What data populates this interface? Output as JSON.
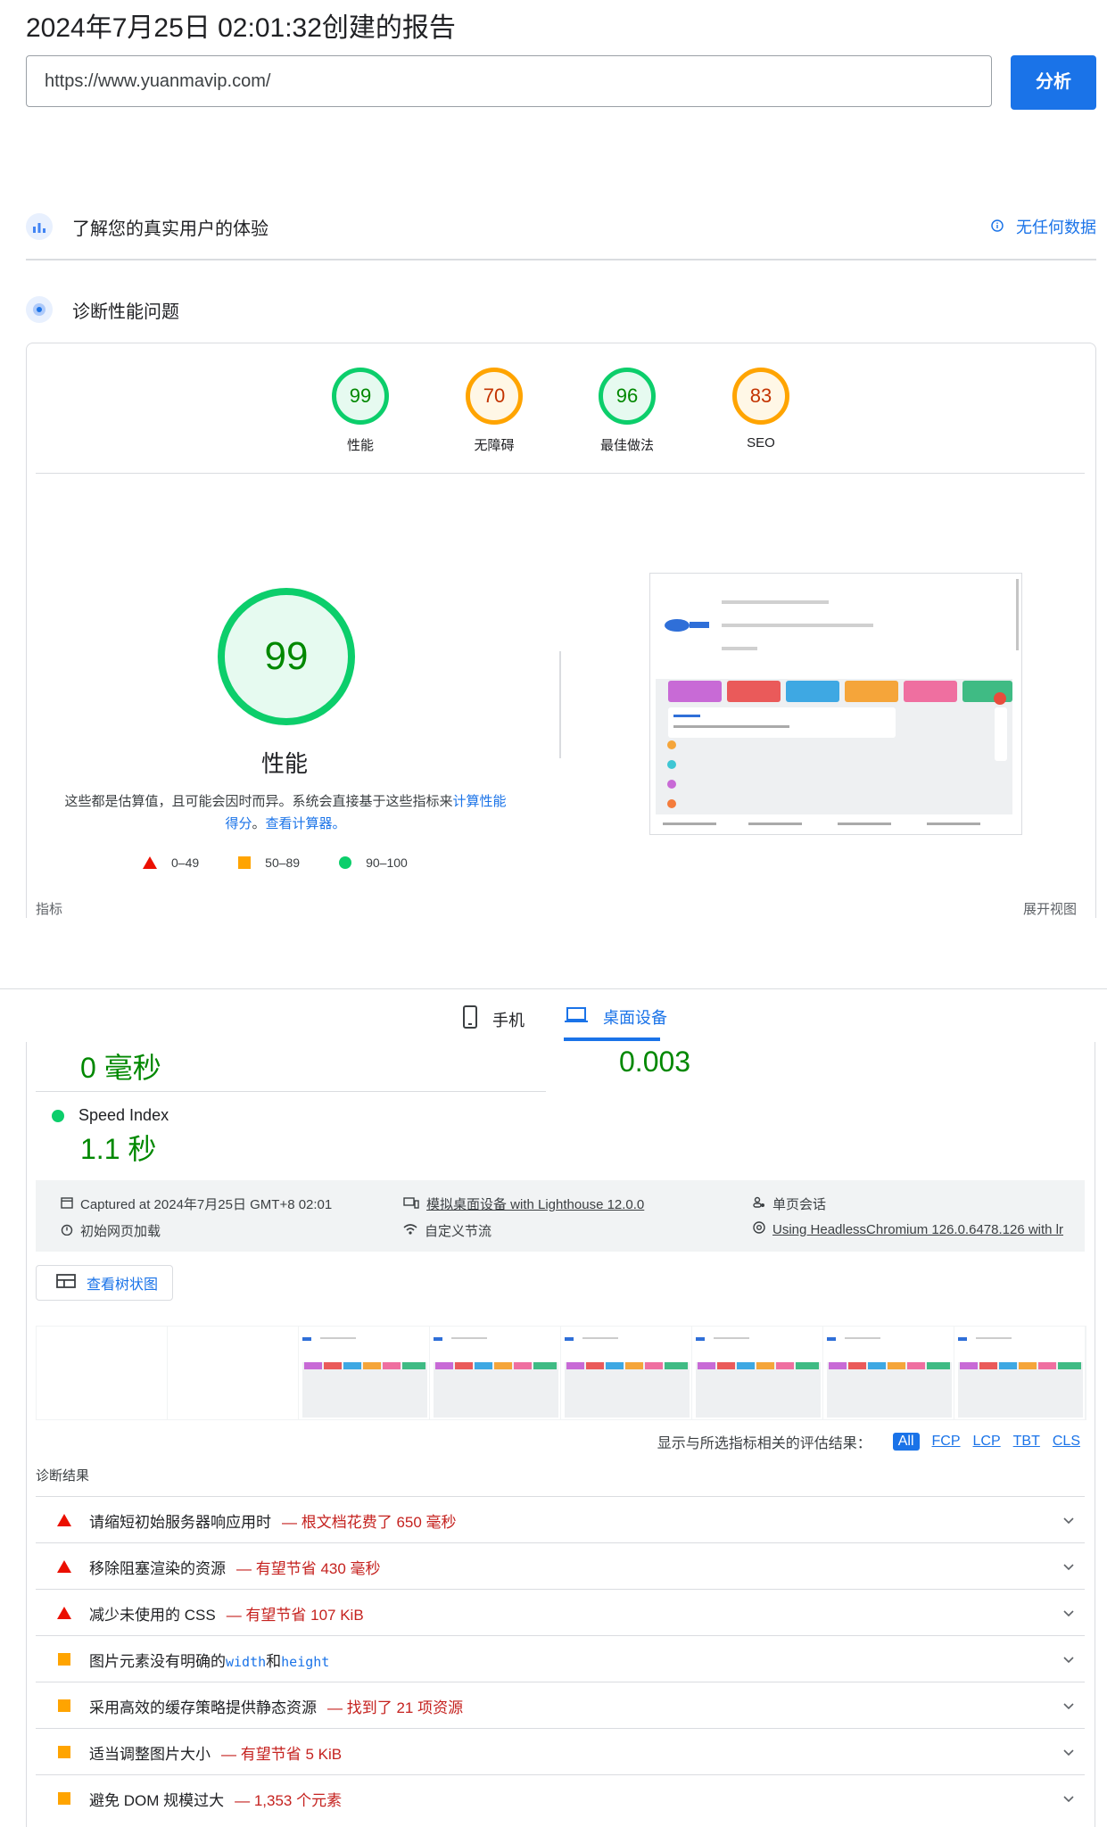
{
  "header": {
    "title": "2024年7月25日 02:01:32创建的报告",
    "url_value": "https://www.yuanmavip.com/",
    "analyze_label": "分析"
  },
  "crux": {
    "label": "了解您的真实用户的体验",
    "no_data": "无任何数据"
  },
  "diagnose": {
    "label": "诊断性能问题"
  },
  "scores": [
    {
      "value": "99",
      "label": "性能"
    },
    {
      "value": "70",
      "label": "无障碍"
    },
    {
      "value": "96",
      "label": "最佳做法"
    },
    {
      "value": "83",
      "label": "SEO"
    }
  ],
  "performance": {
    "score": "99",
    "label": "性能",
    "desc_prefix": "这些都是估算值，且可能会因时而异。系统会直接基于这些指标来",
    "desc_link1": "计算性能得分",
    "desc_sep": "。",
    "desc_link2": "查看计算器",
    "desc_end": "。",
    "legend": [
      "0–49",
      "50–89",
      "90–100"
    ],
    "metrics_label": "指标",
    "expand_label": "展开视图"
  },
  "tabs": {
    "mobile": "手机",
    "desktop": "桌面设备"
  },
  "metrics": {
    "tbt_value": "0 毫秒",
    "cls_value": "0.003",
    "si_label": "Speed Index",
    "si_value": "1.1 秒"
  },
  "meta": {
    "captured": "Captured at 2024年7月25日 GMT+8 02:01",
    "initial_load": "初始网页加载",
    "emulated": "模拟桌面设备 with Lighthouse 12.0.0",
    "throttling": "自定义节流",
    "session": "单页会话",
    "browser": "Using HeadlessChromium 126.0.6478.126 with lr"
  },
  "treemap_label": "查看树状图",
  "filter": {
    "label": "显示与所选指标相关的评估结果：",
    "chips": [
      "All",
      "FCP",
      "LCP",
      "TBT",
      "CLS"
    ]
  },
  "diagnostics": {
    "title": "诊断结果",
    "items": [
      {
        "severity": "fail",
        "title": "请缩短初始服务器响应用时",
        "display": "— 根文档花费了 650 毫秒"
      },
      {
        "severity": "fail",
        "title": "移除阻塞渲染的资源",
        "display": "— 有望节省 430 毫秒"
      },
      {
        "severity": "fail",
        "title": "减少未使用的 CSS",
        "display": "— 有望节省 107 KiB"
      },
      {
        "severity": "average",
        "title_a": "图片元素没有明确的",
        "code1": "width",
        "title_b": "和",
        "code2": "height"
      },
      {
        "severity": "average",
        "title": "采用高效的缓存策略提供静态资源",
        "display": "— 找到了 21 项资源"
      },
      {
        "severity": "average",
        "title": "适当调整图片大小",
        "display": "— 有望节省 5 KiB"
      },
      {
        "severity": "average",
        "title": "避免 DOM 规模过大",
        "display": "— 1,353 个元素"
      }
    ]
  },
  "colors": {
    "accent": "#1a73e8",
    "pass": "#0cce6b",
    "average": "#ffa400",
    "fail": "#eb0f00"
  }
}
